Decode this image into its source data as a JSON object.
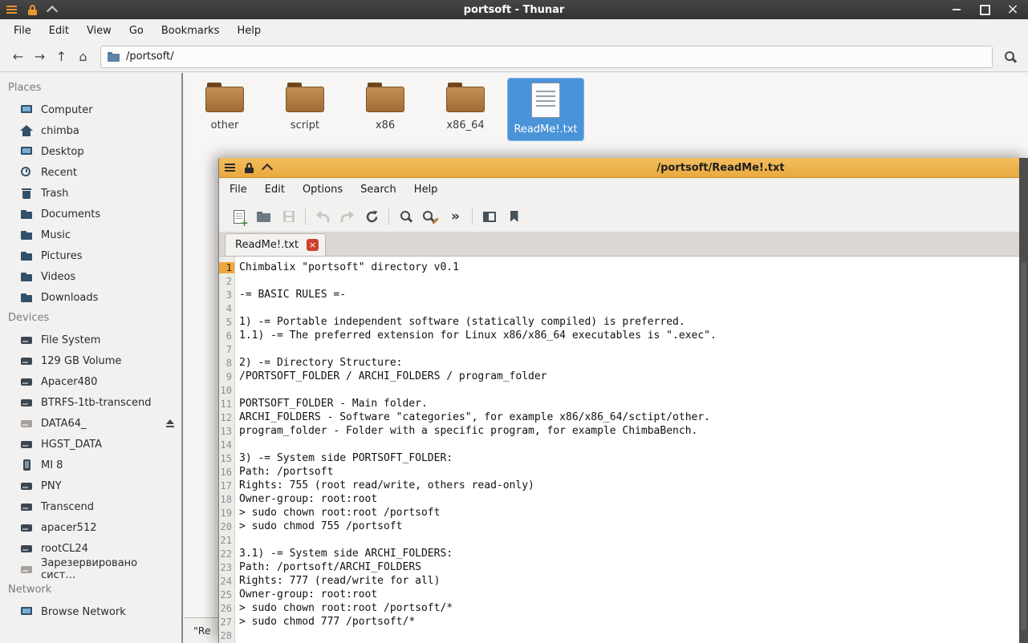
{
  "colors": {
    "titlebar_dark": "#3b3b3b",
    "editor_titlebar_orange": "#edb04a",
    "selection_blue": "#4b93d8",
    "current_line_marker": "#efa73d",
    "tab_close_red": "#cf3f2e",
    "folder_brown": "#a06c34"
  },
  "icons": {
    "back": "←",
    "forward": "→",
    "up": "↑",
    "home": "⌂",
    "chevron_double": "»",
    "window_close": "×",
    "tab_close": "×"
  },
  "thunar": {
    "titlebar": {
      "title": "portsoft - Thunar"
    },
    "menubar": [
      "File",
      "Edit",
      "View",
      "Go",
      "Bookmarks",
      "Help"
    ],
    "toolbar": {
      "path": "/portsoft/"
    },
    "sidebar": {
      "places": {
        "heading": "Places",
        "items": [
          {
            "label": "Computer",
            "icon": "computer"
          },
          {
            "label": "chimba",
            "icon": "home"
          },
          {
            "label": "Desktop",
            "icon": "desktop"
          },
          {
            "label": "Recent",
            "icon": "recent"
          },
          {
            "label": "Trash",
            "icon": "trash"
          },
          {
            "label": "Documents",
            "icon": "folder"
          },
          {
            "label": "Music",
            "icon": "folder"
          },
          {
            "label": "Pictures",
            "icon": "folder"
          },
          {
            "label": "Videos",
            "icon": "folder"
          },
          {
            "label": "Downloads",
            "icon": "folder"
          }
        ]
      },
      "devices": {
        "heading": "Devices",
        "items": [
          {
            "label": "File System",
            "icon": "drive"
          },
          {
            "label": "129 GB Volume",
            "icon": "drive"
          },
          {
            "label": "Apacer480",
            "icon": "drive"
          },
          {
            "label": "BTRFS-1tb-transcend",
            "icon": "drive"
          },
          {
            "label": "DATA64_",
            "icon": "drive-muted",
            "eject": true
          },
          {
            "label": "HGST_DATA",
            "icon": "drive"
          },
          {
            "label": "MI 8",
            "icon": "phone"
          },
          {
            "label": "PNY",
            "icon": "drive"
          },
          {
            "label": "Transcend",
            "icon": "drive"
          },
          {
            "label": "apacer512",
            "icon": "drive"
          },
          {
            "label": "rootCL24",
            "icon": "drive"
          },
          {
            "label": "Зарезервировано сист…",
            "icon": "drive-muted"
          }
        ]
      },
      "network": {
        "heading": "Network",
        "items": [
          {
            "label": "Browse Network",
            "icon": "network"
          }
        ]
      }
    },
    "files": [
      {
        "label": "other",
        "icon": "folder"
      },
      {
        "label": "script",
        "icon": "folder"
      },
      {
        "label": "x86",
        "icon": "folder"
      },
      {
        "label": "x86_64",
        "icon": "folder"
      },
      {
        "label": "ReadMe!.txt",
        "icon": "text-file",
        "selected": true
      }
    ],
    "statusbar": {
      "text": "\"Re"
    }
  },
  "editor": {
    "titlebar": {
      "title": "/portsoft/ReadMe!.txt"
    },
    "menubar": [
      "File",
      "Edit",
      "Options",
      "Search",
      "Help"
    ],
    "tabs": [
      {
        "label": "ReadMe!.txt"
      }
    ],
    "lines": [
      {
        "n": "1",
        "text": "Chimbalix \"portsoft\" directory v0.1"
      },
      {
        "n": "2",
        "text": ""
      },
      {
        "n": "3",
        "text": "-= BASIC RULES =-"
      },
      {
        "n": "4",
        "text": ""
      },
      {
        "n": "5",
        "text": "1) -= Portable independent software (statically compiled) is preferred."
      },
      {
        "n": "6",
        "text": "1.1) -= The preferred extension for Linux x86/x86_64 executables is \".exec\"."
      },
      {
        "n": "7",
        "text": ""
      },
      {
        "n": "8",
        "text": "2) -= Directory Structure:"
      },
      {
        "n": "9",
        "text": "/PORTSOFT_FOLDER / ARCHI_FOLDERS / program_folder"
      },
      {
        "n": "10",
        "text": ""
      },
      {
        "n": "11",
        "text": "PORTSOFT_FOLDER - Main folder."
      },
      {
        "n": "12",
        "text": "ARCHI_FOLDERS - Software \"categories\", for example x86/x86_64/sctipt/other."
      },
      {
        "n": "13",
        "text": "program_folder - Folder with a specific program, for example ChimbaBench."
      },
      {
        "n": "14",
        "text": ""
      },
      {
        "n": "15",
        "text": "3) -= System side PORTSOFT_FOLDER:"
      },
      {
        "n": "16",
        "text": "Path: /portsoft"
      },
      {
        "n": "17",
        "text": "Rights: 755 (root read/write, others read-only)"
      },
      {
        "n": "18",
        "text": "Owner-group: root:root"
      },
      {
        "n": "19",
        "text": "> sudo chown root:root /portsoft"
      },
      {
        "n": "20",
        "text": "> sudo chmod 755 /portsoft"
      },
      {
        "n": "21",
        "text": ""
      },
      {
        "n": "22",
        "text": "3.1) -= System side ARCHI_FOLDERS:"
      },
      {
        "n": "23",
        "text": "Path: /portsoft/ARCHI_FOLDERS"
      },
      {
        "n": "24",
        "text": "Rights: 777 (read/write for all)"
      },
      {
        "n": "25",
        "text": "Owner-group: root:root"
      },
      {
        "n": "26",
        "text": "> sudo chown root:root /portsoft/*"
      },
      {
        "n": "27",
        "text": "> sudo chmod 777 /portsoft/*"
      },
      {
        "n": "28",
        "text": ""
      }
    ]
  }
}
